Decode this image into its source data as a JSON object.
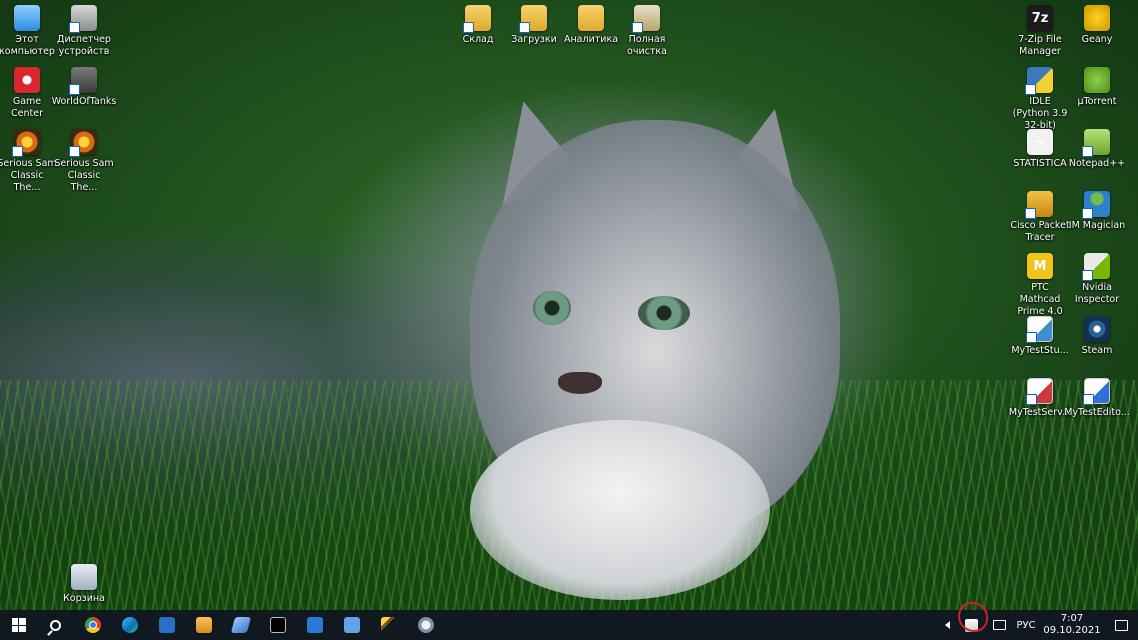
{
  "desktop": {
    "icons_left": [
      {
        "label": "Этот компьютер",
        "icon": "this-pc-icon"
      },
      {
        "label": "Диспетчер устройств",
        "icon": "device-manager-icon"
      },
      {
        "label": "Game Center",
        "icon": "game-center-icon"
      },
      {
        "label": "WorldOfTanks",
        "icon": "world-of-tanks-icon"
      },
      {
        "label": "Serious Sam Classic The...",
        "icon": "serious-sam-icon"
      },
      {
        "label": "Serious Sam Classic The...",
        "icon": "serious-sam-icon"
      }
    ],
    "icons_top": [
      {
        "label": "Склад",
        "icon": "folder-icon"
      },
      {
        "label": "Загрузки",
        "icon": "downloads-folder-icon"
      },
      {
        "label": "Аналитика",
        "icon": "folder-icon"
      },
      {
        "label": "Полная очистка",
        "icon": "cleanup-icon"
      }
    ],
    "icons_right": [
      {
        "label": "7-Zip File Manager",
        "icon": "7zip-icon"
      },
      {
        "label": "Geany",
        "icon": "geany-icon"
      },
      {
        "label": "IDLE (Python 3.9 32-bit)",
        "icon": "python-idle-icon"
      },
      {
        "label": "µTorrent",
        "icon": "utorrent-icon"
      },
      {
        "label": "STATISTICA",
        "icon": "statistica-icon"
      },
      {
        "label": "Notepad++",
        "icon": "notepad-plus-plus-icon"
      },
      {
        "label": "Cisco Packet Tracer",
        "icon": "cisco-packet-tracer-icon"
      },
      {
        "label": "IM Magician",
        "icon": "im-magician-icon"
      },
      {
        "label": "PTC Mathcad Prime 4.0",
        "icon": "mathcad-icon"
      },
      {
        "label": "Nvidia Inspector",
        "icon": "nvidia-inspector-icon"
      },
      {
        "label": "MyTestStu...",
        "icon": "mytest-student-icon"
      },
      {
        "label": "Steam",
        "icon": "steam-icon"
      },
      {
        "label": "MyTestServ...",
        "icon": "mytest-server-icon"
      },
      {
        "label": "MyTestEdito...",
        "icon": "mytest-editor-icon"
      }
    ],
    "recycle_bin": {
      "label": "Корзина",
      "icon": "recycle-bin-icon"
    }
  },
  "taskbar": {
    "start": "start-icon",
    "search": "search-icon",
    "pinned": [
      "chrome-icon",
      "edge-icon",
      "powershell-icon",
      "media-player-icon",
      "card-app-icon",
      "command-prompt-icon",
      "visual-studio-icon",
      "mail-app-icon",
      "wand-app-icon",
      "packet-tracer-icon"
    ],
    "tray": {
      "language": "РУС",
      "time": "7:07",
      "date": "09.10.2021"
    }
  },
  "colors": {
    "taskbar_bg": "#101820",
    "highlight_circle": "#d0202a"
  }
}
